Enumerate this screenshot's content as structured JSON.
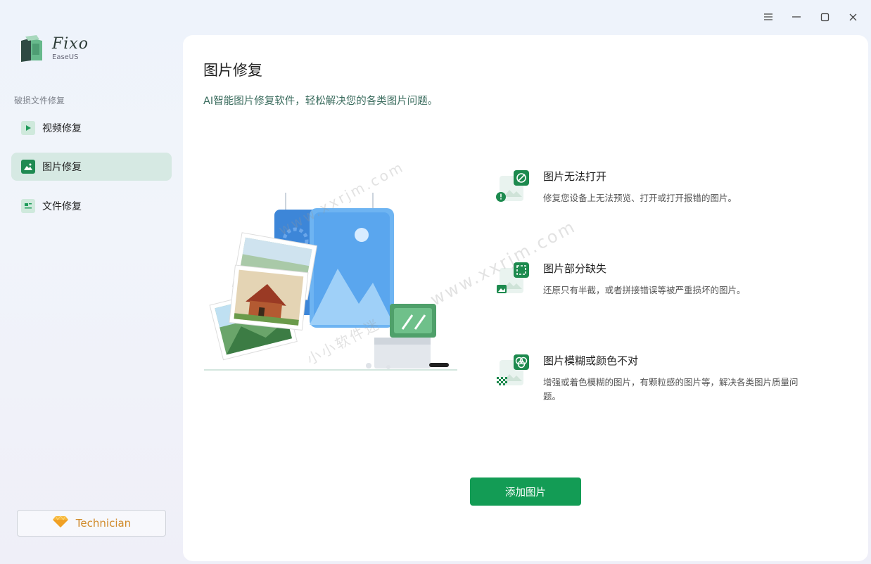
{
  "app": {
    "name": "Fixo",
    "vendor": "EaseUS"
  },
  "window_controls": [
    "menu-icon",
    "minimize-icon",
    "maximize-icon",
    "close-icon"
  ],
  "sidebar": {
    "section_label": "破损文件修复",
    "items": [
      {
        "label": "视频修复",
        "icon": "video-icon",
        "active": false
      },
      {
        "label": "图片修复",
        "icon": "image-icon",
        "active": true
      },
      {
        "label": "文件修复",
        "icon": "document-icon",
        "active": false
      }
    ],
    "technician_label": "Technician"
  },
  "main": {
    "title": "图片修复",
    "subtitle": "AI智能图片修复软件，轻松解决您的各类图片问题。",
    "features": [
      {
        "title": "图片无法打开",
        "desc": "修复您设备上无法预览、打开或打开报错的图片。",
        "icon": "broken-image-icon"
      },
      {
        "title": "图片部分缺失",
        "desc": "还原只有半截，或者拼接错误等被严重损坏的图片。",
        "icon": "partial-image-icon"
      },
      {
        "title": "图片模糊或颜色不对",
        "desc": "增强或着色模糊的图片，有颗粒感的图片等，解决各类图片质量问题。",
        "icon": "blurry-image-icon"
      }
    ],
    "add_button": "添加图片"
  },
  "watermark": {
    "text1": "www.xxrjm.com",
    "text2": "小小软件迷",
    "text3": "www.xxrjm.com"
  },
  "colors": {
    "accent": "#139c55",
    "active_nav": "#d6e9e3",
    "technician": "#d08a2a"
  }
}
